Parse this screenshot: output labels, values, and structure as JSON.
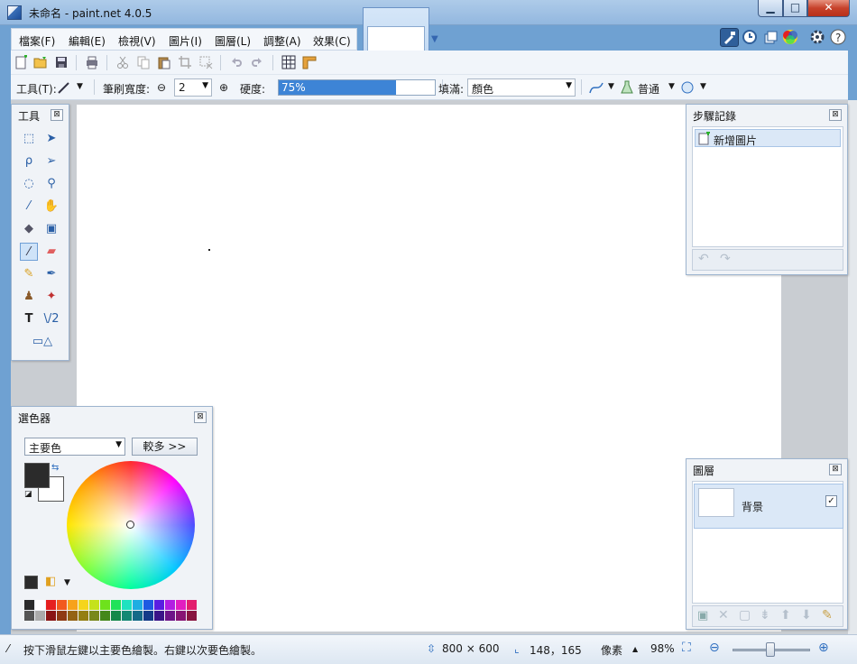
{
  "window": {
    "title": "未命名 - paint.net 4.0.5",
    "minimize": "▁",
    "maximize": "□",
    "close": "✕"
  },
  "menu": {
    "items": [
      "檔案(F)",
      "編輯(E)",
      "檢視(V)",
      "圖片(I)",
      "圖層(L)",
      "調整(A)",
      "效果(C)"
    ]
  },
  "toolbar": {
    "tool_label": "工具(T):",
    "brush_width_label": "筆刷寬度:",
    "brush_width_value": "2",
    "brush_minus": "⊖",
    "brush_plus": "⊕",
    "hardness_label": "硬度:",
    "hardness_value": "75%",
    "hardness_fraction": 0.75,
    "fill_label": "填滿:",
    "fill_value": "顏色",
    "blend_mode": "普通"
  },
  "tools_panel": {
    "title": "工具"
  },
  "history_panel": {
    "title": "步驟記錄",
    "items": [
      "新增圖片"
    ]
  },
  "color_panel": {
    "title": "選色器",
    "mode_select": "主要色",
    "more_button": "較多 >>",
    "primary_color": "#2b2b2b",
    "secondary_color": "#ffffff",
    "palette_row1": [
      "#2b2b2b",
      "#ffffff",
      "#e62020",
      "#f25a1e",
      "#f7a21b",
      "#f5d51b",
      "#c5e21c",
      "#6ee21c",
      "#20e25a",
      "#1ee2c0",
      "#1eaee2",
      "#1e5ae2",
      "#5a1ee2",
      "#b21ee2",
      "#e21ec0",
      "#e21e6e"
    ],
    "palette_row2": [
      "#555555",
      "#aaaaaa",
      "#8a1414",
      "#8f3a14",
      "#946214",
      "#947f14",
      "#78881a",
      "#44881a",
      "#14884a",
      "#148874",
      "#146a88",
      "#143a88",
      "#3a1488",
      "#6e1488",
      "#881474",
      "#881440"
    ]
  },
  "layers_panel": {
    "title": "圖層",
    "layers": [
      {
        "name": "背景",
        "visible": "✓"
      }
    ]
  },
  "status": {
    "hint": "按下滑鼠左鍵以主要色繪製。右鍵以次要色繪製。",
    "image_size": "800 × 600",
    "cursor_pos": "148，165",
    "unit": "像素",
    "zoom": "98%"
  }
}
